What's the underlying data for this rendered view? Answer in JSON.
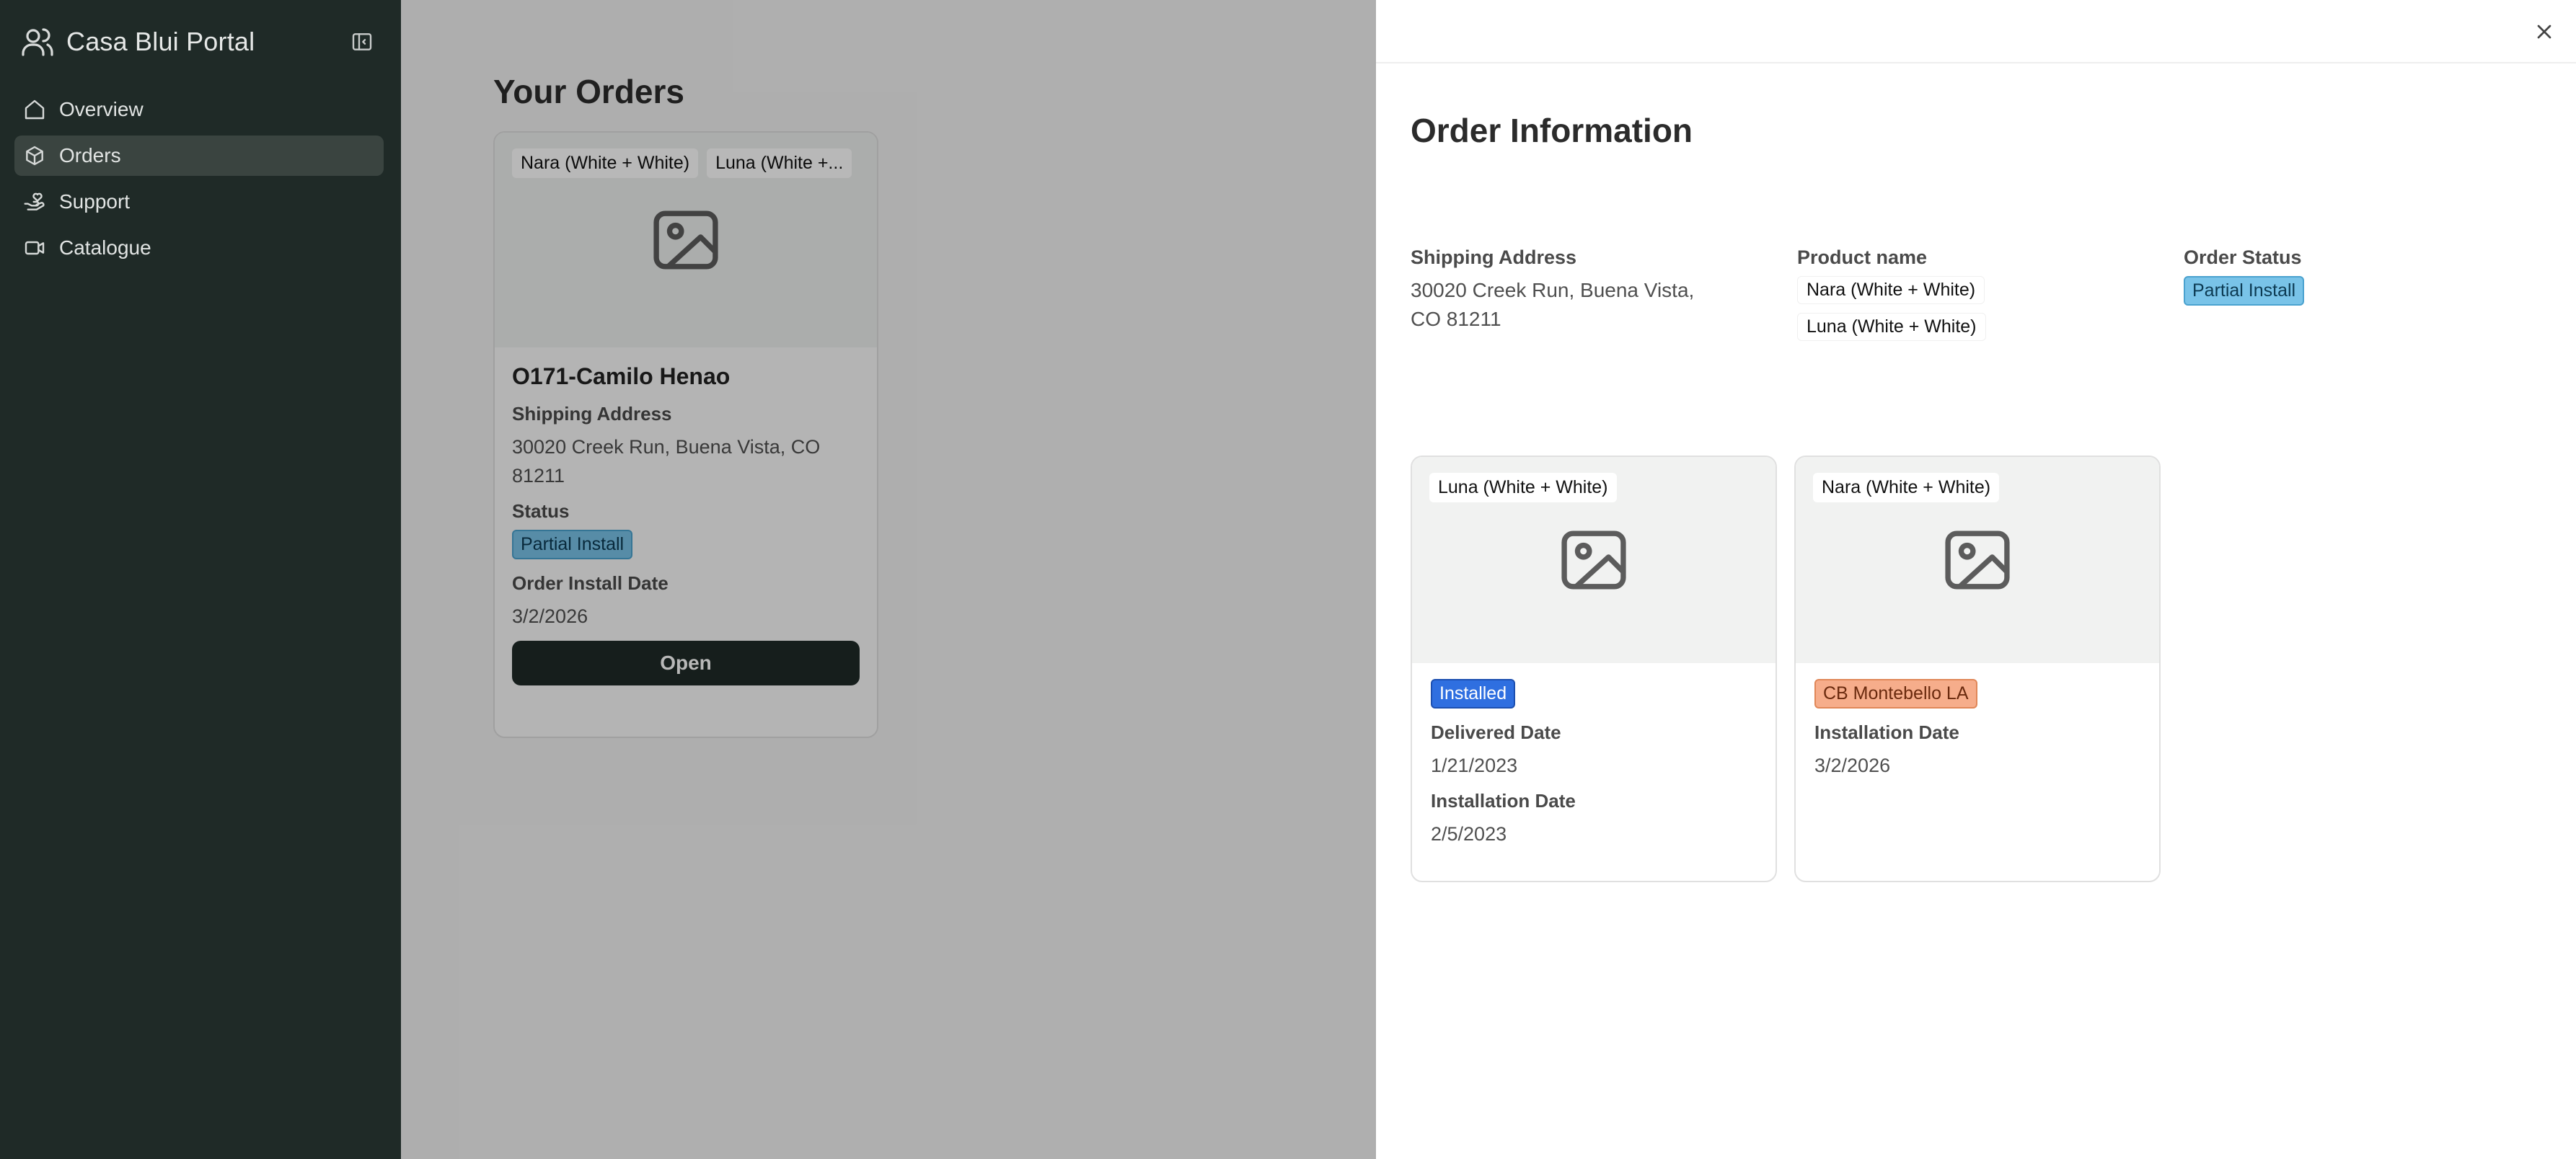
{
  "app": {
    "title": "Casa Blui Portal"
  },
  "sidebar": {
    "items": [
      {
        "label": "Overview",
        "icon": "home-icon",
        "active": false
      },
      {
        "label": "Orders",
        "icon": "box-icon",
        "active": true
      },
      {
        "label": "Support",
        "icon": "hand-heart-icon",
        "active": false
      },
      {
        "label": "Catalogue",
        "icon": "video-icon",
        "active": false
      }
    ]
  },
  "main": {
    "title": "Your Orders",
    "order_card": {
      "chips": [
        "Nara (White + White)",
        "Luna (White +..."
      ],
      "title": "O171-Camilo Henao",
      "shipping_label": "Shipping Address",
      "shipping_value": "30020 Creek Run, Buena Vista, CO 81211",
      "status_label": "Status",
      "status_value": "Partial Install",
      "install_label": "Order Install Date",
      "install_value": "3/2/2026",
      "open_label": "Open"
    }
  },
  "drawer": {
    "title": "Order Information",
    "shipping_label": "Shipping Address",
    "shipping_value": "30020 Creek Run, Buena Vista, CO 81211",
    "product_label": "Product name",
    "products": [
      "Nara (White + White)",
      "Luna (White + White)"
    ],
    "status_label": "Order Status",
    "status_value": "Partial Install",
    "items": [
      {
        "chip": "Luna (White + White)",
        "badge": "Installed",
        "field1_label": "Delivered Date",
        "field1_value": "1/21/2023",
        "field2_label": "Installation Date",
        "field2_value": "2/5/2023"
      },
      {
        "chip": "Nara (White + White)",
        "badge": "CB Montebello LA",
        "field1_label": "Installation Date",
        "field1_value": "3/2/2026"
      }
    ]
  },
  "colors": {
    "sidebar_bg": "#1f2a27",
    "partial_badge": "#79c3e8",
    "installed_badge": "#2f6fe0",
    "location_badge": "#f6ad8b"
  }
}
